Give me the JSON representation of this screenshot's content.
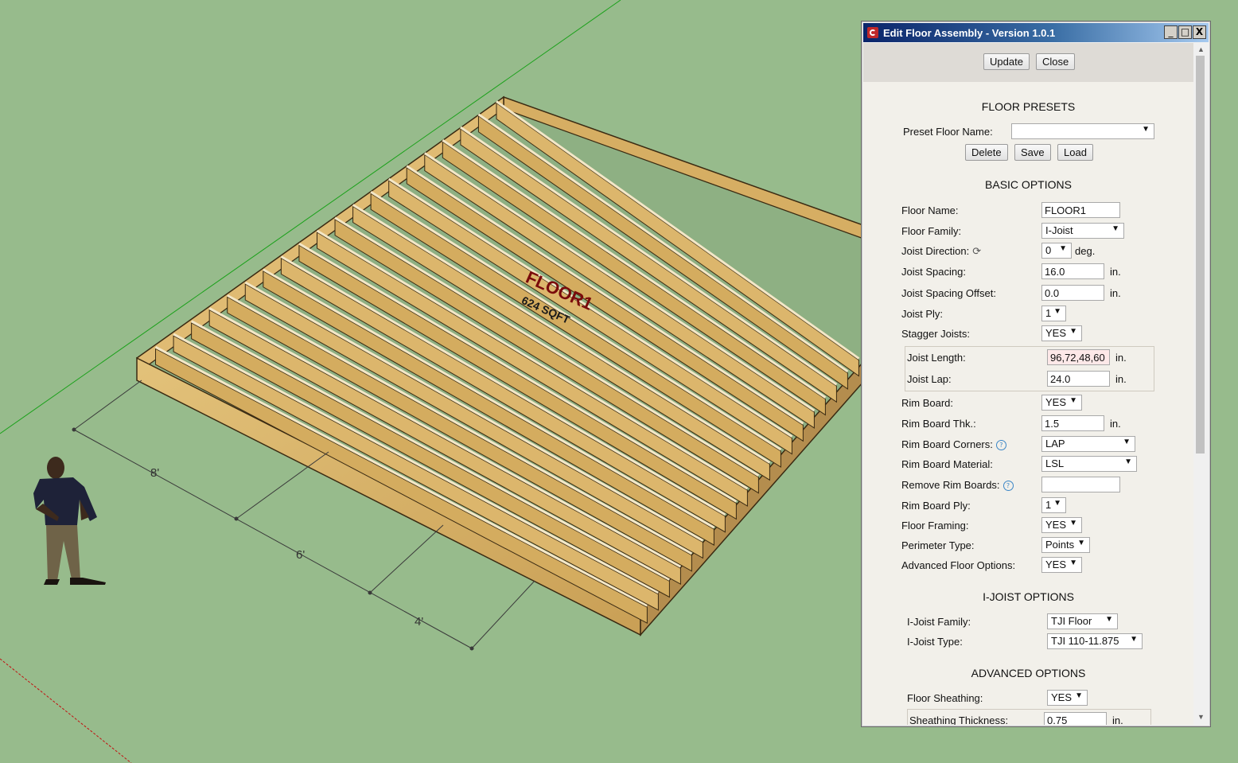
{
  "scene": {
    "floor_label": "FLOOR1",
    "floor_area": "624 SQFT",
    "dimensions": [
      "8'",
      "6'",
      "4'"
    ],
    "colors": {
      "ground": "#97bb8c",
      "wood": "#d9b46a",
      "edge": "#3a2a12",
      "axis_green": "#1aa11a",
      "axis_red": "#c21010"
    }
  },
  "dialog": {
    "title": "Edit Floor Assembly - Version 1.0.1",
    "window_controls": {
      "min": "_",
      "max": "□",
      "close": "X"
    },
    "buttons": {
      "update": "Update",
      "close": "Close"
    },
    "presets": {
      "heading": "FLOOR PRESETS",
      "name_label": "Preset Floor Name:",
      "name_value": "",
      "delete": "Delete",
      "save": "Save",
      "load": "Load"
    },
    "basic": {
      "heading": "BASIC OPTIONS",
      "floor_name": {
        "label": "Floor Name:",
        "value": "FLOOR1"
      },
      "floor_family": {
        "label": "Floor Family:",
        "value": "I-Joist"
      },
      "joist_direction": {
        "label": "Joist Direction:",
        "value": "0",
        "unit": "deg."
      },
      "joist_spacing": {
        "label": "Joist Spacing:",
        "value": "16.0",
        "unit": "in."
      },
      "joist_spacing_offset": {
        "label": "Joist Spacing Offset:",
        "value": "0.0",
        "unit": "in."
      },
      "joist_ply": {
        "label": "Joist Ply:",
        "value": "1"
      },
      "stagger_joists": {
        "label": "Stagger Joists:",
        "value": "YES"
      },
      "joist_length": {
        "label": "Joist Length:",
        "value": "96,72,48,60",
        "unit": "in."
      },
      "joist_lap": {
        "label": "Joist Lap:",
        "value": "24.0",
        "unit": "in."
      },
      "rim_board": {
        "label": "Rim Board:",
        "value": "YES"
      },
      "rim_board_thk": {
        "label": "Rim Board Thk.:",
        "value": "1.5",
        "unit": "in."
      },
      "rim_board_corners": {
        "label": "Rim Board Corners:",
        "value": "LAP"
      },
      "rim_board_material": {
        "label": "Rim Board Material:",
        "value": "LSL"
      },
      "remove_rim_boards": {
        "label": "Remove Rim Boards:",
        "value": ""
      },
      "rim_board_ply": {
        "label": "Rim Board Ply:",
        "value": "1"
      },
      "floor_framing": {
        "label": "Floor Framing:",
        "value": "YES"
      },
      "perimeter_type": {
        "label": "Perimeter Type:",
        "value": "Points"
      },
      "advanced_floor_options": {
        "label": "Advanced Floor Options:",
        "value": "YES"
      }
    },
    "ijoist": {
      "heading": "I-JOIST OPTIONS",
      "family": {
        "label": "I-Joist Family:",
        "value": "TJI Floor"
      },
      "type": {
        "label": "I-Joist Type:",
        "value": "TJI 110-11.875"
      }
    },
    "advanced": {
      "heading": "ADVANCED OPTIONS",
      "floor_sheathing": {
        "label": "Floor Sheathing:",
        "value": "YES"
      },
      "sheathing_thickness": {
        "label": "Sheathing Thickness:",
        "value": "0.75",
        "unit": "in."
      }
    }
  }
}
